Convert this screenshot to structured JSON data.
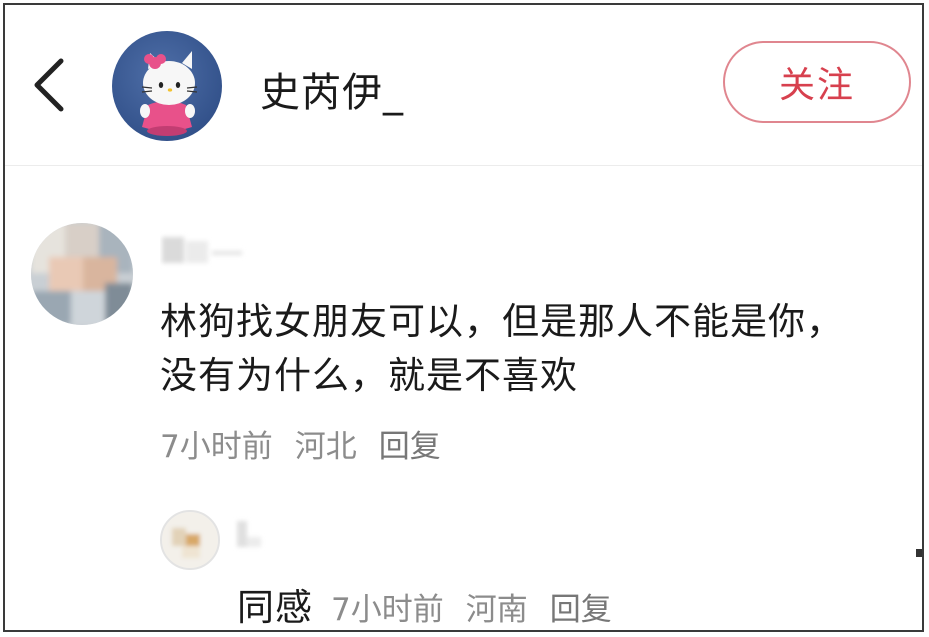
{
  "header": {
    "username": "史芮伊_",
    "follow_label": "关注"
  },
  "comment": {
    "text": "林狗找女朋友可以，但是那人不能是你，没有为什么，就是不喜欢",
    "time": "7小时前",
    "location": "河北",
    "reply_label": "回复"
  },
  "reply": {
    "text": "同感",
    "time": "7小时前",
    "location": "河南",
    "reply_label": "回复"
  },
  "icons": {
    "back": "chevron-left-icon",
    "avatar_main": "hello-kitty-avatar",
    "avatar_comment": "blurred-avatar",
    "avatar_reply": "blurred-avatar"
  },
  "colors": {
    "accent": "#d7404e",
    "follow_border": "#e0868f",
    "meta_text": "#8c8c8c",
    "avatar_bg": "#34538c"
  }
}
